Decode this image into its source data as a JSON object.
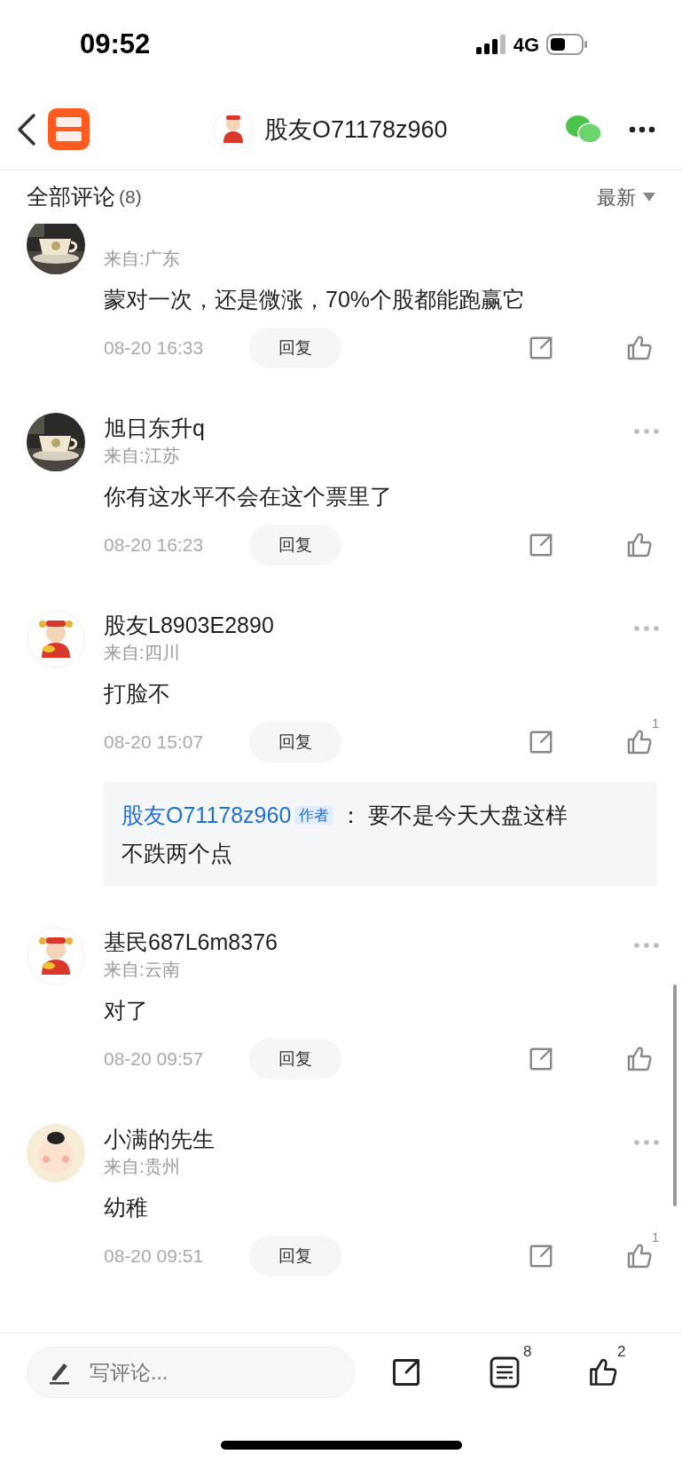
{
  "status_bar": {
    "time": "09:52",
    "network": "4G"
  },
  "header": {
    "title": "股友O71178z960"
  },
  "comments_header": {
    "title": "全部评论",
    "count": "(8)",
    "sort": "最新"
  },
  "comments": [
    {
      "location": "来自:广东",
      "text": "蒙对一次，还是微涨，70%个股都能跑赢它",
      "time": "08-20 16:33",
      "reply_label": "回复"
    },
    {
      "name": "旭日东升q",
      "location": "来自:江苏",
      "text": "你有这水平不会在这个票里了",
      "time": "08-20 16:23",
      "reply_label": "回复"
    },
    {
      "avatar": {
        "kind": "figure"
      },
      "name": "股友L8903E2890",
      "location": "来自:四川",
      "text": "打脸不",
      "time": "08-20 15:07",
      "reply_label": "回复",
      "likes": "1",
      "reply": {
        "author": "股友O71178z960",
        "badge": "作者",
        "separator": "：",
        "text": "要不是今天大盘这样不跌两个点"
      }
    },
    {
      "avatar": {
        "kind": "figure"
      },
      "name": "基民687L6m8376",
      "location": "来自:云南",
      "text": "对了",
      "time": "08-20 09:57",
      "reply_label": "回复"
    },
    {
      "avatar": {
        "kind": "cartoon"
      },
      "name": "小满的先生",
      "location": "来自:贵州",
      "text": "幼稚",
      "time": "08-20 09:51",
      "reply_label": "回复",
      "likes": "1"
    }
  ],
  "bottom_bar": {
    "placeholder": "写评论...",
    "comment_count": "8",
    "like_count": "2"
  }
}
